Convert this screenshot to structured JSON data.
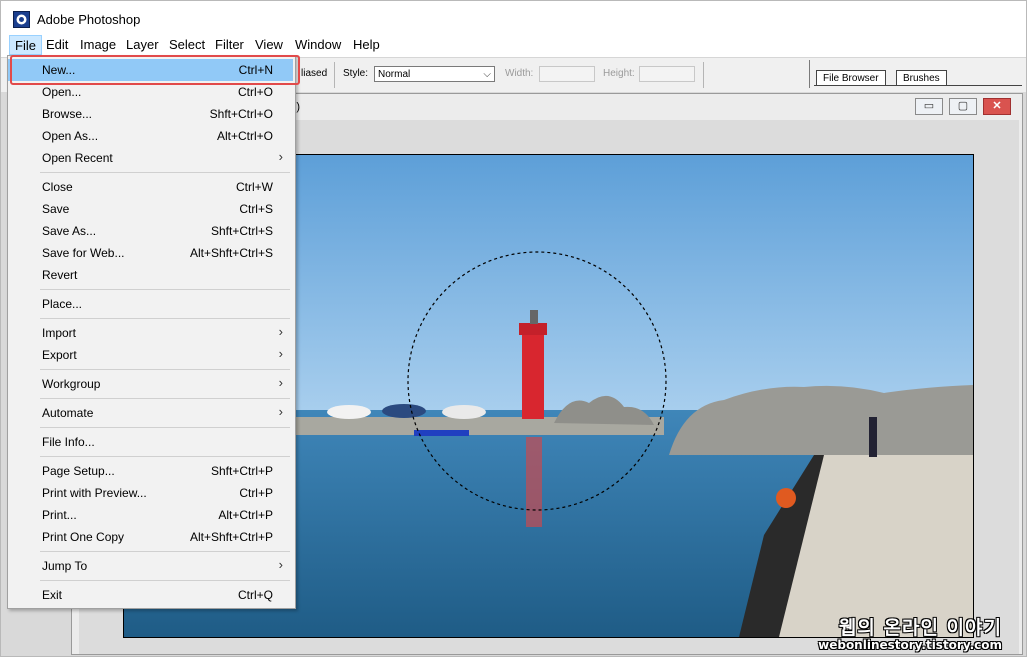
{
  "app": {
    "title": "Adobe Photoshop"
  },
  "menubar": [
    "File",
    "Edit",
    "Image",
    "Layer",
    "Select",
    "Filter",
    "View",
    "Window",
    "Help"
  ],
  "options": {
    "antialiased_label": "liased",
    "style_label": "Style:",
    "style_value": "Normal",
    "width_label": "Width:",
    "height_label": "Height:"
  },
  "palette_well": {
    "tabs": [
      "File Browser",
      "Brushes"
    ]
  },
  "document": {
    "title_fragment": "B)",
    "minimize": "▭",
    "maximize": "▢",
    "close": "✕"
  },
  "file_menu": {
    "items": [
      {
        "label": "New...",
        "shortcut": "Ctrl+N"
      },
      {
        "label": "Open...",
        "shortcut": "Ctrl+O"
      },
      {
        "label": "Browse...",
        "shortcut": "Shft+Ctrl+O"
      },
      {
        "label": "Open As...",
        "shortcut": "Alt+Ctrl+O"
      },
      {
        "label": "Open Recent",
        "shortcut": ""
      },
      {
        "label": "Close",
        "shortcut": "Ctrl+W"
      },
      {
        "label": "Save",
        "shortcut": "Ctrl+S"
      },
      {
        "label": "Save As...",
        "shortcut": "Shft+Ctrl+S"
      },
      {
        "label": "Save for Web...",
        "shortcut": "Alt+Shft+Ctrl+S"
      },
      {
        "label": "Revert",
        "shortcut": ""
      },
      {
        "label": "Place...",
        "shortcut": ""
      },
      {
        "label": "Import",
        "shortcut": ""
      },
      {
        "label": "Export",
        "shortcut": ""
      },
      {
        "label": "Workgroup",
        "shortcut": ""
      },
      {
        "label": "Automate",
        "shortcut": ""
      },
      {
        "label": "File Info...",
        "shortcut": ""
      },
      {
        "label": "Page Setup...",
        "shortcut": "Shft+Ctrl+P"
      },
      {
        "label": "Print with Preview...",
        "shortcut": "Ctrl+P"
      },
      {
        "label": "Print...",
        "shortcut": "Alt+Ctrl+P"
      },
      {
        "label": "Print One Copy",
        "shortcut": "Alt+Shft+Ctrl+P"
      },
      {
        "label": "Jump To",
        "shortcut": ""
      },
      {
        "label": "Exit",
        "shortcut": "Ctrl+Q"
      }
    ],
    "submenu_arrow": "›"
  },
  "watermark": {
    "korean": "웹의 온라인 이야기",
    "url": "webonlinestory.tistory.com"
  }
}
